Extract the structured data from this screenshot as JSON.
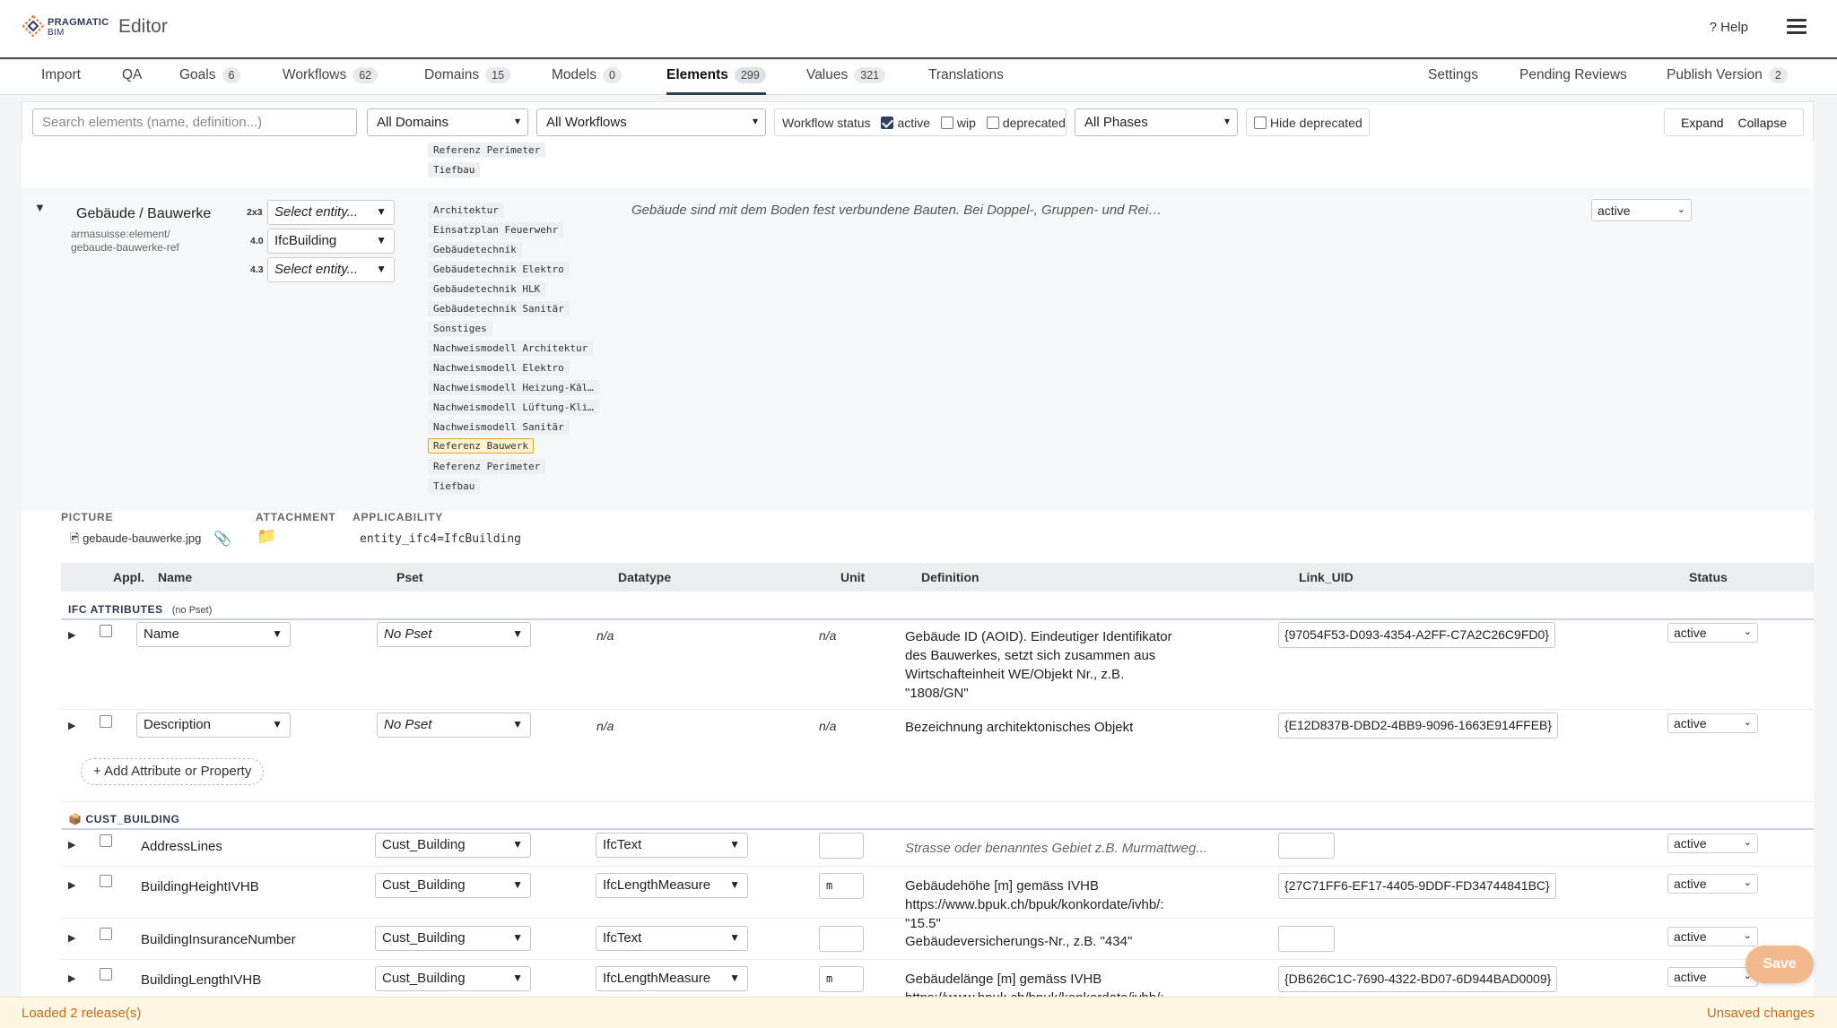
{
  "app": {
    "logo_line1": "PRAGMATIC",
    "logo_line2": "BIM",
    "title": "Editor",
    "help": "? Help"
  },
  "tabs": [
    {
      "label": "Import"
    },
    {
      "label": "QA"
    },
    {
      "label": "Goals",
      "count": "6"
    },
    {
      "label": "Workflows",
      "count": "62"
    },
    {
      "label": "Domains",
      "count": "15"
    },
    {
      "label": "Models",
      "count": "0"
    },
    {
      "label": "Elements",
      "count": "299",
      "active": true
    },
    {
      "label": "Values",
      "count": "321"
    },
    {
      "label": "Translations"
    }
  ],
  "right_tabs": [
    {
      "label": "Settings"
    },
    {
      "label": "Pending Reviews"
    },
    {
      "label": "Publish Version",
      "count": "2"
    }
  ],
  "filters": {
    "search_placeholder": "Search elements (name, definition...)",
    "domains": "All Domains",
    "workflows": "All Workflows",
    "workflow_status_label": "Workflow status",
    "status_active": "active",
    "status_wip": "wip",
    "status_deprecated": "deprecated",
    "phases": "All Phases",
    "hide_deprecated": "Hide deprecated",
    "expand": "Expand",
    "collapse": "Collapse"
  },
  "prev_tags": [
    "Referenz Perimeter",
    "Tiefbau"
  ],
  "element": {
    "name": "Gebäude / Bauwerke",
    "ref_line1": "armasuisse:element/",
    "ref_line2": "gebaude-bauwerke-ref",
    "versions": [
      {
        "ver": "2x3",
        "entity": "Select entity..."
      },
      {
        "ver": "4.0",
        "entity": "IfcBuilding"
      },
      {
        "ver": "4.3",
        "entity": "Select entity..."
      }
    ],
    "tags": [
      {
        "label": "Architektur"
      },
      {
        "label": "Einsatzplan Feuerwehr"
      },
      {
        "label": "Gebäudetechnik"
      },
      {
        "label": "Gebäudetechnik Elektro"
      },
      {
        "label": "Gebäudetechnik HLK"
      },
      {
        "label": "Gebäudetechnik Sanitär"
      },
      {
        "label": "Sonstiges"
      },
      {
        "label": "Nachweismodell Architektur"
      },
      {
        "label": "Nachweismodell Elektro"
      },
      {
        "label": "Nachweismodell Heizung-Käl…"
      },
      {
        "label": "Nachweismodell Lüftung-Kli…"
      },
      {
        "label": "Nachweismodell Sanitär"
      },
      {
        "label": "Referenz Bauwerk",
        "highlight": true
      },
      {
        "label": "Referenz Perimeter"
      },
      {
        "label": "Tiefbau"
      }
    ],
    "definition": "Gebäude sind mit dem Boden fest verbundene Bauten. Bei Doppel-, Gruppen- und Rei…",
    "status": "active",
    "picture_label": "PICTURE",
    "attachment_label": "ATTACHMENT",
    "applicability_label": "APPLICABILITY",
    "picture_file": "gebaude-bauwerke.jpg",
    "applicability": "entity_ifc4=IfcBuilding"
  },
  "table": {
    "headers": {
      "appl": "Appl.",
      "name": "Name",
      "pset": "Pset",
      "datatype": "Datatype",
      "unit": "Unit",
      "definition": "Definition",
      "link_uid": "Link_UID",
      "status": "Status"
    },
    "section1": {
      "title": "IFC ATTRIBUTES",
      "note": "(no Pset)"
    },
    "ifc_rows": [
      {
        "name": "Name",
        "pset": "No Pset",
        "datatype": "n/a",
        "unit": "n/a",
        "definition": "Gebäude ID (AOID). Eindeutiger Identifikator des Bauwerkes, setzt sich zusammen aus Wirtschafteinheit WE/Objekt Nr., z.B. \"1808/GN\"",
        "uid": "{97054F53-D093-4354-A2FF-C7A2C26C9FD0}",
        "status": "active"
      },
      {
        "name": "Description",
        "pset": "No Pset",
        "datatype": "n/a",
        "unit": "n/a",
        "definition": "Bezeichnung architektonisches Objekt",
        "uid": "{E12D837B-DBD2-4BB9-9096-1663E914FFEB}",
        "status": "active"
      }
    ],
    "add_button": "+ Add Attribute or Property",
    "section2": {
      "title": "CUST_BUILDING"
    },
    "cust_rows": [
      {
        "name": "AddressLines",
        "pset": "Cust_Building",
        "datatype": "IfcText",
        "unit": "",
        "definition": "Strasse oder benanntes Gebiet z.B. Murmattweg...",
        "uid": "",
        "status": "active"
      },
      {
        "name": "BuildingHeightIVHB",
        "pset": "Cust_Building",
        "datatype": "IfcLengthMeasure",
        "unit": "m",
        "definition": "Gebäudehöhe [m] gemäss IVHB https://www.bpuk.ch/bpuk/konkordate/ivhb/: \"15.5\"",
        "uid": "{27C71FF6-EF17-4405-9DDF-FD34744841BC}",
        "status": "active"
      },
      {
        "name": "BuildingInsuranceNumber",
        "pset": "Cust_Building",
        "datatype": "IfcText",
        "unit": "",
        "definition": "Gebäudeversicherungs-Nr., z.B. \"434\"",
        "uid": "",
        "status": "active"
      },
      {
        "name": "BuildingLengthIVHB",
        "pset": "Cust_Building",
        "datatype": "IfcLengthMeasure",
        "unit": "m",
        "definition": "Gebäudelänge [m] gemäss IVHB https://www.bpuk.ch/bpuk/konkordate/ivhb/: z.B.",
        "uid": "{DB626C1C-7690-4322-BD07-6D944BAD0009}",
        "status": "active"
      }
    ]
  },
  "footer": {
    "loaded": "Loaded 2 release(s)",
    "unsaved": "Unsaved changes",
    "save": "Save"
  }
}
